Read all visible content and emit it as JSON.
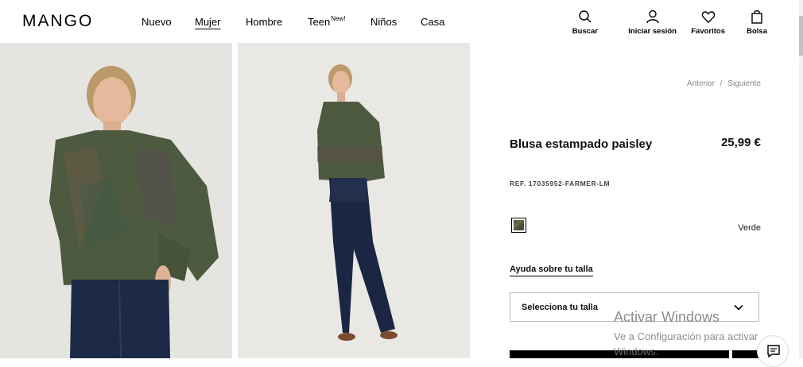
{
  "header": {
    "logo": "MANGO",
    "nav": [
      {
        "label": "Nuevo",
        "badge": ""
      },
      {
        "label": "Mujer",
        "badge": "",
        "active": true
      },
      {
        "label": "Hombre",
        "badge": ""
      },
      {
        "label": "Teen",
        "badge": "New!"
      },
      {
        "label": "Niños",
        "badge": ""
      },
      {
        "label": "Casa",
        "badge": ""
      }
    ],
    "tools": {
      "search": "Buscar",
      "login": "Iniciar sesión",
      "favorites": "Favoritos",
      "bag": "Bolsa"
    }
  },
  "navigation": {
    "previous": "Anterior",
    "separator": "/",
    "next": "Siguiente"
  },
  "product": {
    "title": "Blusa estampado paisley",
    "price": "25,99 €",
    "ref": "REF. 17035952-FARMER-LM",
    "color_name": "Verde",
    "size_help": "Ayuda sobre tu talla",
    "size_select": "Selecciona tu talla"
  },
  "windows_overlay": {
    "title": "Activar Windows",
    "message": "Ve a Configuración para activar Windows."
  },
  "icons": {
    "search": "search-icon",
    "user": "user-icon",
    "heart": "heart-icon",
    "bag": "bag-icon",
    "chevron": "chevron-down-icon",
    "chat": "chat-icon"
  }
}
